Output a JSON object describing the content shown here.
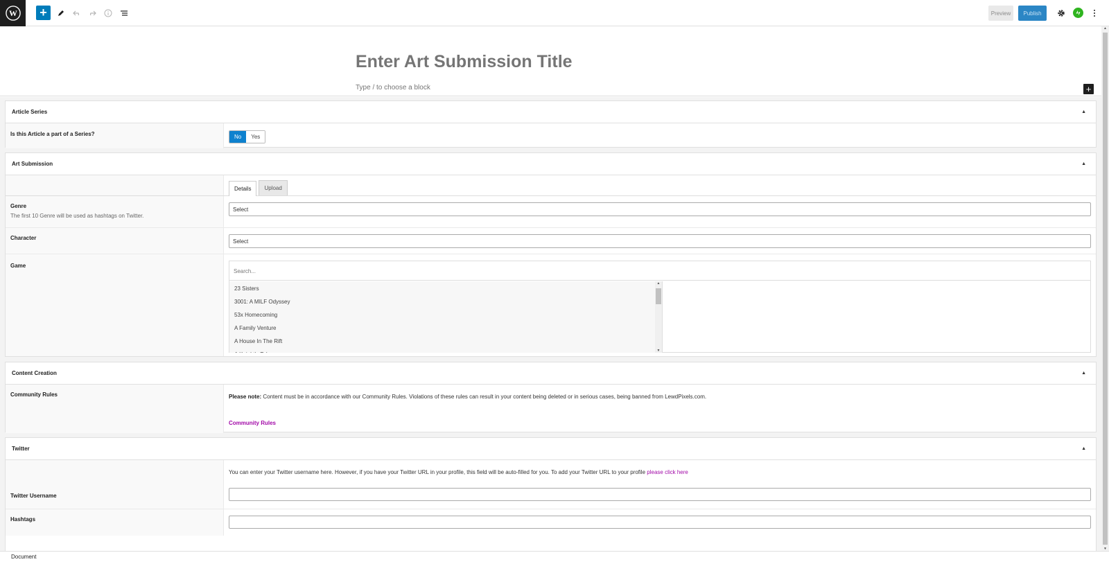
{
  "toolbar": {
    "add_icon": "+",
    "preview_label": "Preview",
    "publish_label": "Publish"
  },
  "editor": {
    "title_placeholder": "Enter Art Submission Title",
    "block_hint": "Type / to choose a block"
  },
  "article_series": {
    "title": "Article Series",
    "question": "Is this Article a part of a Series?",
    "options": [
      "No",
      "Yes"
    ],
    "selected": "No"
  },
  "art_submission": {
    "title": "Art Submission",
    "tabs": [
      "Details",
      "Upload"
    ],
    "active_tab": "Details",
    "genre": {
      "label": "Genre",
      "description": "The first 10 Genre will be used as hashtags on Twitter.",
      "value": "Select"
    },
    "character": {
      "label": "Character",
      "value": "Select"
    },
    "game": {
      "label": "Game",
      "search_placeholder": "Search...",
      "items": [
        "23 Sisters",
        "3001: A MILF Odyssey",
        "53x Homecoming",
        "A Family Venture",
        "A House In The Rift",
        "A Knight's Tale"
      ]
    }
  },
  "content_creation": {
    "title": "Content Creation",
    "label": "Community Rules",
    "note_bold": "Please note:",
    "note_text": " Content must be in accordance with our Community Rules. Violations of these rules can result in your content being deleted or in serious cases, being banned from LewdPixels.com.",
    "link": "Community Rules"
  },
  "twitter": {
    "title": "Twitter",
    "info_text": "You can enter your Twitter username here. However, if you have your Twitter URL in your profile, this field will be auto-filled for you. To add your Twitter URL to your profile ",
    "info_link": "please click here",
    "username_label": "Twitter Username",
    "hashtags_label": "Hashtags"
  },
  "footer": {
    "breadcrumb": "Document"
  },
  "colors": {
    "primary": "#007cba",
    "toggle_on": "#0e81ce",
    "link": "#a20aa8",
    "jetpack": "#2fb41f"
  }
}
